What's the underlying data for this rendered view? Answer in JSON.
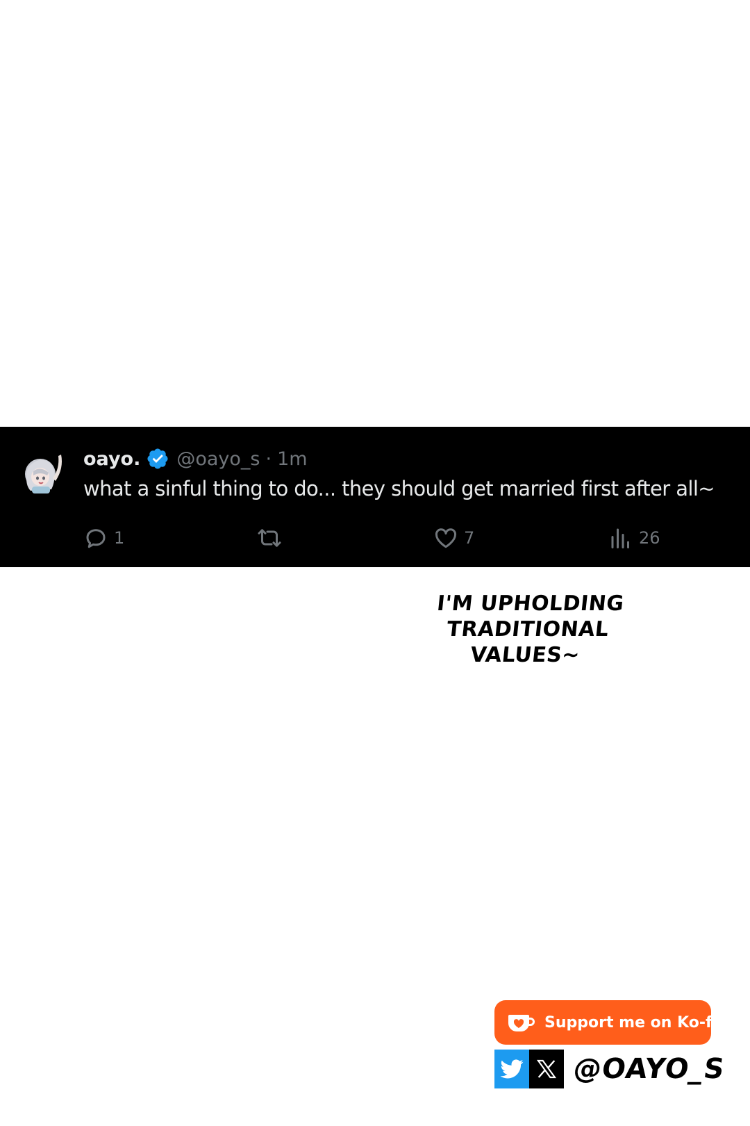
{
  "tweet": {
    "display_name": "oayo.",
    "handle": "@oayo_s",
    "separator": "·",
    "timestamp": "1m",
    "text": "what a sinful thing to do... they should get married first after all~",
    "actions": {
      "reply_count": "1",
      "retweet_count": "",
      "like_count": "7",
      "views_count": "26"
    },
    "icons": {
      "avatar": "avatar",
      "verified": "verified-badge-icon",
      "reply": "reply-icon",
      "retweet": "retweet-icon",
      "like": "heart-icon",
      "views": "views-icon"
    }
  },
  "caption": {
    "lines": [
      "I'M UPHOLDING",
      "TRADITIONAL",
      "VALUES~"
    ]
  },
  "kofi": {
    "label": "Support me on Ko-fi",
    "color": "#ff5e1b"
  },
  "social": {
    "handle": "@OAYO_S",
    "twitter_color": "#1d9bf0",
    "x_color": "#000000"
  },
  "colors": {
    "tweet_bg": "#000000",
    "tweet_text": "#e7e9ea",
    "tweet_muted": "#71767b",
    "verified": "#1d9bf0"
  }
}
